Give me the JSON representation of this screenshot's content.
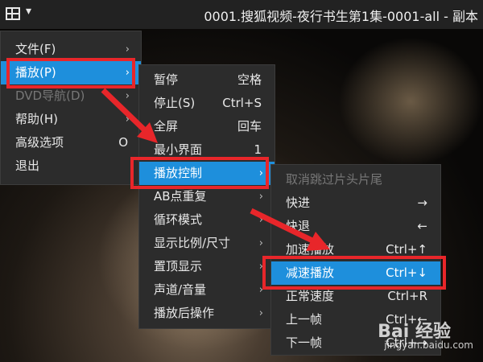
{
  "titlebar": {
    "title": "0001.搜狐视频-夜行书生第1集-0001-all - 副本",
    "menu_icon": "grid-menu-icon",
    "chevron": "chevron-down-icon"
  },
  "main_menu": [
    {
      "label": "文件(F)",
      "arrow": "›"
    },
    {
      "label": "播放(P)",
      "arrow": "›"
    },
    {
      "label": "DVD导航(D)",
      "arrow": "›"
    },
    {
      "label": "帮助(H)",
      "arrow": "›"
    },
    {
      "label": "高级选项",
      "shortcut": "O"
    },
    {
      "label": "退出"
    }
  ],
  "play_menu": [
    {
      "label": "暂停",
      "shortcut": "空格"
    },
    {
      "label": "停止(S)",
      "shortcut": "Ctrl+S"
    },
    {
      "label": "全屏",
      "shortcut": "回车"
    },
    {
      "label": "最小界面",
      "shortcut": "1"
    },
    {
      "label": "播放控制",
      "arrow": "›"
    },
    {
      "label": "AB点重复",
      "arrow": "›"
    },
    {
      "label": "循环模式",
      "arrow": "›"
    },
    {
      "label": "显示比例/尺寸",
      "arrow": "›"
    },
    {
      "label": "置顶显示",
      "arrow": "›"
    },
    {
      "label": "声道/音量",
      "arrow": "›"
    },
    {
      "label": "播放后操作",
      "arrow": "›"
    }
  ],
  "control_menu": [
    {
      "label": "取消跳过片头片尾"
    },
    {
      "label": "快进",
      "shortcut": "→"
    },
    {
      "label": "快退",
      "shortcut": "←"
    },
    {
      "label": "加速播放",
      "shortcut": "Ctrl+↑"
    },
    {
      "label": "减速播放",
      "shortcut": "Ctrl+↓"
    },
    {
      "label": "正常速度",
      "shortcut": "Ctrl+R"
    },
    {
      "label": "上一帧",
      "shortcut": "Ctrl+←"
    },
    {
      "label": "下一帧",
      "shortcut": "Ctrl+→"
    }
  ],
  "watermark": {
    "logo": "Bai 经验",
    "url": "jingyan.baidu.com"
  },
  "colors": {
    "highlight": "#1e8fdc",
    "annotation_red": "#e8262a",
    "menu_bg": "#2c2c2c"
  }
}
